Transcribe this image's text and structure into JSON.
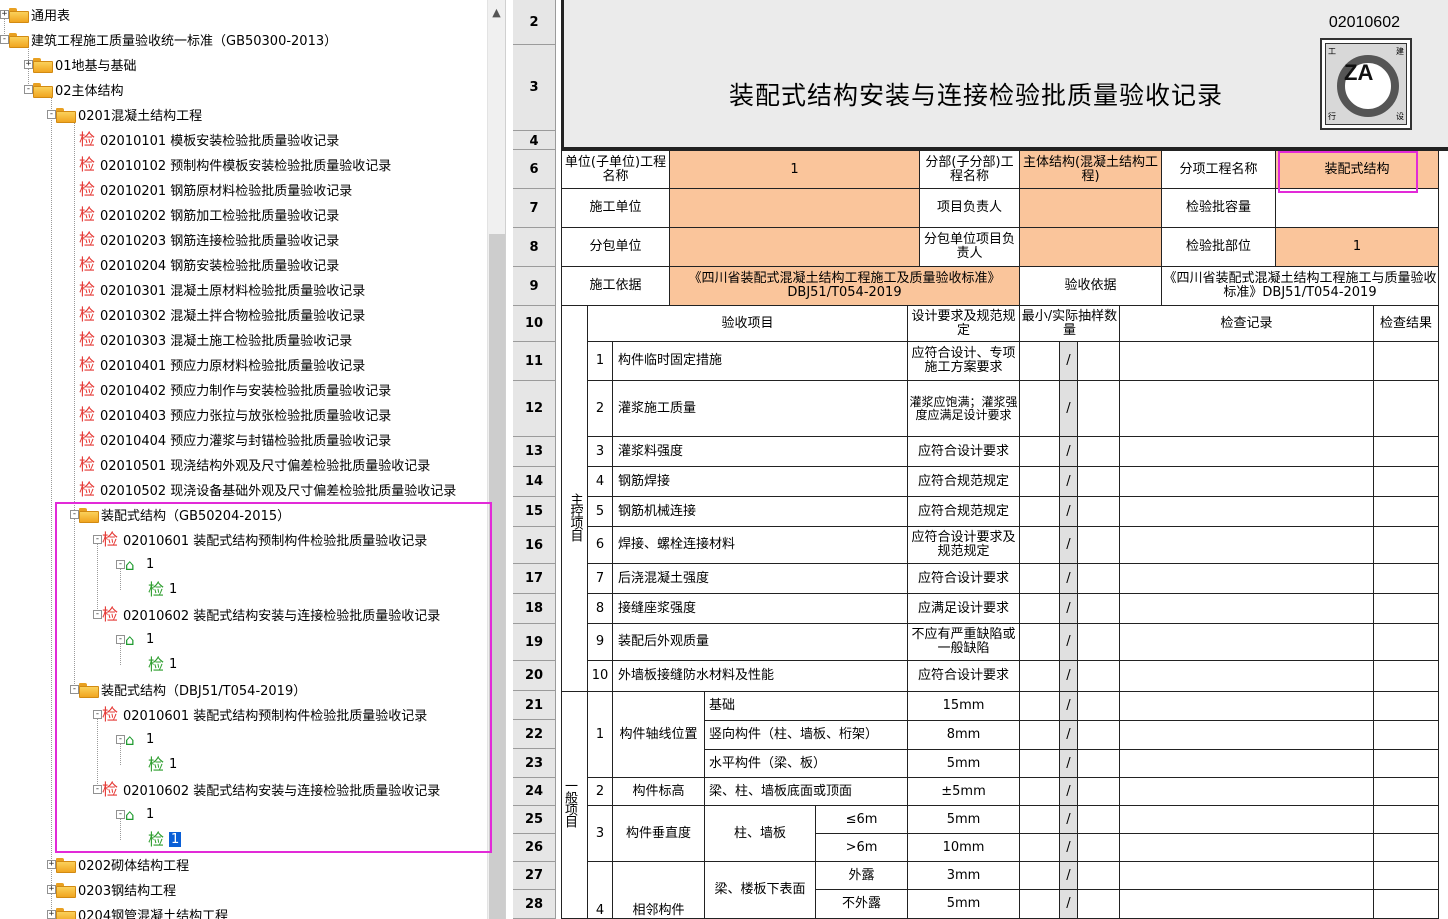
{
  "tree": {
    "nodes": [
      {
        "label": "通用表",
        "kind": "folder",
        "expand": "+"
      },
      {
        "label": "建筑工程施工质量验收统一标准（GB50300-2013）",
        "kind": "folder",
        "expand": "-"
      },
      {
        "label": "01地基与基础",
        "kind": "folder",
        "expand": "+"
      },
      {
        "label": "02主体结构",
        "kind": "folder",
        "expand": "-"
      },
      {
        "label": "0201混凝土结构工程",
        "kind": "folder",
        "expand": "-"
      },
      {
        "label": "02010101  模板安装检验批质量验收记录",
        "kind": "jian"
      },
      {
        "label": "02010102  预制构件模板安装检验批质量验收记录",
        "kind": "jian"
      },
      {
        "label": "02010201  钢筋原材料检验批质量验收记录",
        "kind": "jian"
      },
      {
        "label": "02010202  钢筋加工检验批质量验收记录",
        "kind": "jian"
      },
      {
        "label": "02010203  钢筋连接检验批质量验收记录",
        "kind": "jian"
      },
      {
        "label": "02010204  钢筋安装检验批质量验收记录",
        "kind": "jian"
      },
      {
        "label": "02010301  混凝土原材料检验批质量验收记录",
        "kind": "jian"
      },
      {
        "label": "02010302  混凝土拌合物检验批质量验收记录",
        "kind": "jian"
      },
      {
        "label": "02010303  混凝土施工检验批质量验收记录",
        "kind": "jian"
      },
      {
        "label": "02010401  预应力原材料检验批质量验收记录",
        "kind": "jian"
      },
      {
        "label": "02010402  预应力制作与安装检验批质量验收记录",
        "kind": "jian"
      },
      {
        "label": "02010403  预应力张拉与放张检验批质量验收记录",
        "kind": "jian"
      },
      {
        "label": "02010404  预应力灌浆与封锚检验批质量验收记录",
        "kind": "jian"
      },
      {
        "label": "02010501  现浇结构外观及尺寸偏差检验批质量验收记录",
        "kind": "jian"
      },
      {
        "label": "02010502  现浇设备基础外观及尺寸偏差检验批质量验收记录",
        "kind": "jian"
      },
      {
        "label": "装配式结构（GB50204-2015）",
        "kind": "folder",
        "expand": "-"
      },
      {
        "label": "02010601  装配式结构预制构件检验批质量验收记录",
        "kind": "jian",
        "expand": "-"
      },
      {
        "label": "1",
        "kind": "house",
        "expand": "-"
      },
      {
        "label": "1",
        "kind": "jian-green"
      },
      {
        "label": "02010602  装配式结构安装与连接检验批质量验收记录",
        "kind": "jian",
        "expand": "-"
      },
      {
        "label": "1",
        "kind": "house",
        "expand": "-"
      },
      {
        "label": "1",
        "kind": "jian-green"
      },
      {
        "label": "装配式结构（DBJ51/T054-2019）",
        "kind": "folder",
        "expand": "-"
      },
      {
        "label": "02010601  装配式结构预制构件检验批质量验收记录",
        "kind": "jian",
        "expand": "-"
      },
      {
        "label": "1",
        "kind": "house",
        "expand": "-"
      },
      {
        "label": "1",
        "kind": "jian-green"
      },
      {
        "label": "02010602  装配式结构安装与连接检验批质量验收记录",
        "kind": "jian",
        "expand": "-"
      },
      {
        "label": "1",
        "kind": "house",
        "expand": "-"
      },
      {
        "label": "1",
        "kind": "jian-green",
        "selected": true
      },
      {
        "label": "0202砌体结构工程",
        "kind": "folder",
        "expand": "+"
      },
      {
        "label": "0203钢结构工程",
        "kind": "folder",
        "expand": "+"
      },
      {
        "label": "0204钢管混凝土结构工程",
        "kind": "folder",
        "expand": "+"
      }
    ],
    "jian_char": "检",
    "house_char": "⌂"
  },
  "sheet": {
    "row_numbers": [
      "2",
      "3",
      "4",
      "6",
      "7",
      "8",
      "9",
      "10",
      "11",
      "12",
      "13",
      "14",
      "15",
      "16",
      "17",
      "18",
      "19",
      "20",
      "21",
      "22",
      "23",
      "24",
      "25",
      "26",
      "27",
      "28"
    ],
    "code": "02010602",
    "logo_text": "ZA",
    "logo_corners": [
      "工",
      "建",
      "行",
      "设"
    ],
    "title": "装配式结构安装与连接检验批质量验收记录",
    "info": {
      "unit_label": "单位(子单位)工程名称",
      "unit_value": "1",
      "sub_label": "分部(子分部)工程名称",
      "sub_value": "主体结构(混凝土结构工程)",
      "item_label": "分项工程名称",
      "item_value": "装配式结构",
      "constructor_label": "施工单位",
      "pm_label": "项目负责人",
      "capacity_label": "检验批容量",
      "subcontractor_label": "分包单位",
      "sub_pm_label": "分包单位项目负责人",
      "part_label": "检验批部位",
      "part_value": "1",
      "basis_label": "施工依据",
      "basis_value": "《四川省装配式混凝土结构工程施工及质量验收标准》DBJ51/T054-2019",
      "accept_label": "验收依据",
      "accept_value": "《四川省装配式混凝土结构工程施工与质量验收标准》DBJ51/T054-2019"
    },
    "headers": {
      "item": "验收项目",
      "req": "设计要求及规范规定",
      "sample": "最小/实际抽样数量",
      "record": "检查记录",
      "result": "检查结果"
    },
    "main_label": "主控项目",
    "general_label": "一般项目",
    "slash": "/",
    "main_items": [
      {
        "no": "1",
        "name": "构件临时固定措施",
        "req": "应符合设计、专项施工方案要求"
      },
      {
        "no": "2",
        "name": "灌浆施工质量",
        "req": "灌浆应饱满；灌浆强度应满足设计要求"
      },
      {
        "no": "3",
        "name": "灌浆料强度",
        "req": "应符合设计要求"
      },
      {
        "no": "4",
        "name": "钢筋焊接",
        "req": "应符合规范规定"
      },
      {
        "no": "5",
        "name": "钢筋机械连接",
        "req": "应符合规范规定"
      },
      {
        "no": "6",
        "name": "焊接、螺栓连接材料",
        "req": "应符合设计要求及规范规定"
      },
      {
        "no": "7",
        "name": "后浇混凝土强度",
        "req": "应符合设计要求"
      },
      {
        "no": "8",
        "name": "接缝座浆强度",
        "req": "应满足设计要求"
      },
      {
        "no": "9",
        "name": "装配后外观质量",
        "req": "不应有严重缺陷或一般缺陷"
      },
      {
        "no": "10",
        "name": "外墙板接缝防水材料及性能",
        "req": "应符合设计要求"
      }
    ],
    "general": {
      "g1_no": "1",
      "g1_name": "构件轴线位置",
      "g1_rows": [
        {
          "sub": "基础",
          "val": "15mm"
        },
        {
          "sub": "竖向构件（柱、墙板、桁架）",
          "val": "8mm"
        },
        {
          "sub": "水平构件（梁、板）",
          "val": "5mm"
        }
      ],
      "g2_no": "2",
      "g2_name": "构件标高",
      "g2_sub": "梁、柱、墙板底面或顶面",
      "g2_val": "±5mm",
      "g3_no": "3",
      "g3_name": "构件垂直度",
      "g3_sub": "柱、墙板",
      "g3_rows": [
        {
          "cond": "≤6m",
          "val": "5mm"
        },
        {
          "cond": ">6m",
          "val": "10mm"
        }
      ],
      "g4_no": "4",
      "g4_name": "相邻构件",
      "g4_sub": "梁、楼板下表面",
      "g4_rows": [
        {
          "cond": "外露",
          "val": "3mm"
        },
        {
          "cond": "不外露",
          "val": "5mm"
        }
      ]
    }
  }
}
